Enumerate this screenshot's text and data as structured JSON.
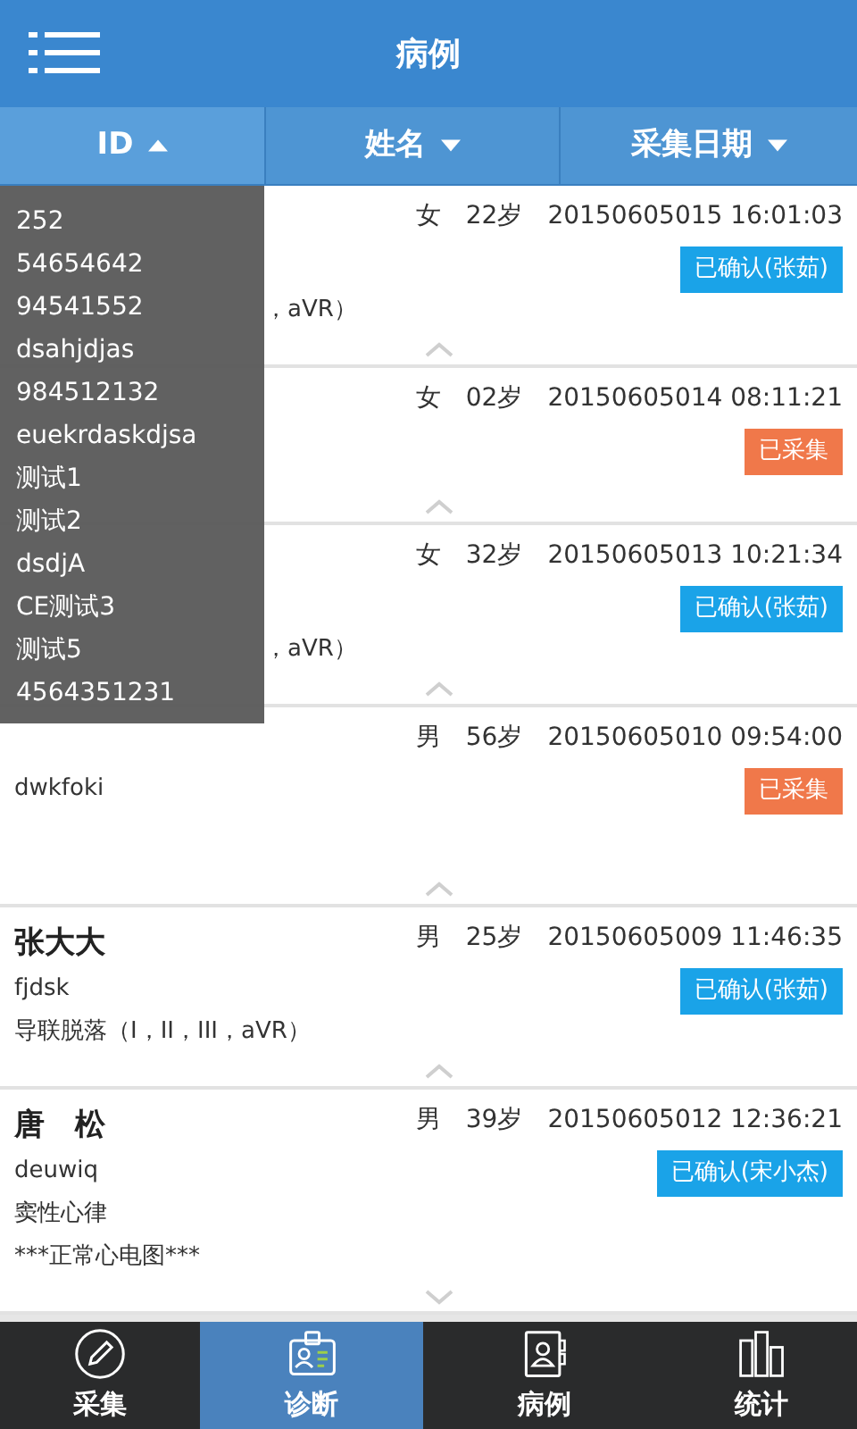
{
  "header": {
    "title": "病例"
  },
  "sort_bar": [
    {
      "label": "ID",
      "ascending": true,
      "selected": true
    },
    {
      "label": "姓名",
      "ascending": false,
      "selected": false
    },
    {
      "label": "采集日期",
      "ascending": false,
      "selected": false
    }
  ],
  "id_dropdown": [
    "252",
    "54654642",
    "94541552",
    "dsahjdjas",
    "984512132",
    "euekrdaskdjsa",
    "测试1",
    "测试2",
    "dsdjA",
    "CE测试3",
    "测试5",
    "4564351231"
  ],
  "records": [
    {
      "gender": "女",
      "age": "22岁",
      "datetime": "20150605015 16:01:03",
      "status": {
        "label": "已确认(张茹)",
        "kind": "confirmed"
      },
      "text_beside_menu": "，aVR）",
      "expanded": true
    },
    {
      "gender": "女",
      "age": "02岁",
      "datetime": "20150605014 08:11:21",
      "status": {
        "label": "已采集",
        "kind": "collected"
      },
      "expanded": true
    },
    {
      "gender": "女",
      "age": "32岁",
      "datetime": "20150605013 10:21:34",
      "status": {
        "label": "已确认(张茹)",
        "kind": "confirmed"
      },
      "text_beside_menu": "，aVR）",
      "expanded": true
    },
    {
      "gender": "男",
      "age": "56岁",
      "datetime": "20150605010 09:54:00",
      "status": {
        "label": "已采集",
        "kind": "collected"
      },
      "lines": [
        "dwkfoki"
      ],
      "expanded": true
    },
    {
      "name": "张大大",
      "gender": "男",
      "age": "25岁",
      "datetime": "20150605009 11:46:35",
      "status": {
        "label": "已确认(张茹)",
        "kind": "confirmed"
      },
      "lines": [
        "fjdsk",
        "导联脱落（I，II，III，aVR）"
      ],
      "expanded": true
    },
    {
      "name": "唐　松",
      "gender": "男",
      "age": "39岁",
      "datetime": "20150605012 12:36:21",
      "status": {
        "label": "已确认(宋小杰)",
        "kind": "confirmed"
      },
      "lines": [
        "deuwiq",
        "窦性心律",
        "***正常心电图***"
      ],
      "expanded": false
    }
  ],
  "bottom_nav": [
    {
      "label": "采集",
      "selected": false
    },
    {
      "label": "诊断",
      "selected": true
    },
    {
      "label": "病例",
      "selected": false
    },
    {
      "label": "统计",
      "selected": false
    }
  ]
}
